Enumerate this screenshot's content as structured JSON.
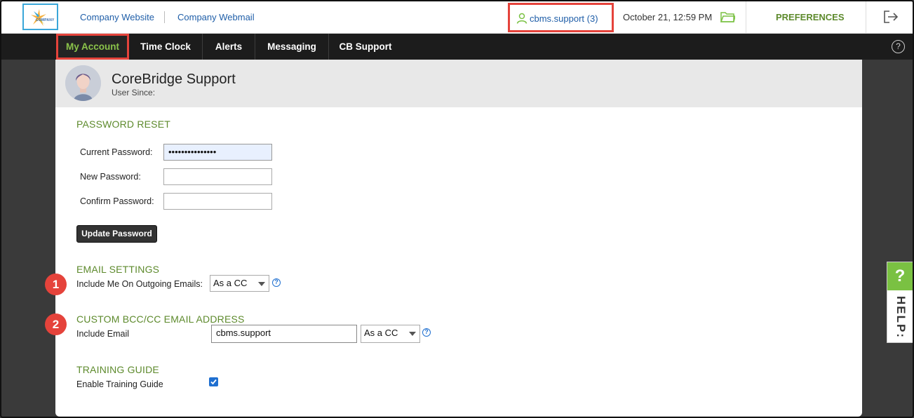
{
  "header": {
    "logo_text": "COMPANY",
    "links": [
      "Company Website",
      "Company Webmail"
    ],
    "user_label": "cbms.support (3)",
    "datetime": "October 21, 12:59 PM",
    "preferences_label": "PREFERENCES"
  },
  "nav": {
    "items": [
      "My Account",
      "Time Clock",
      "Alerts",
      "Messaging",
      "CB Support"
    ],
    "active": "My Account",
    "help_glyph": "?"
  },
  "profile": {
    "name": "CoreBridge Support",
    "since_label": "User Since:"
  },
  "password_reset": {
    "title": "PASSWORD RESET",
    "current_label": "Current Password:",
    "current_value": "•••••••••••••••",
    "new_label": "New Password:",
    "new_value": "",
    "confirm_label": "Confirm Password:",
    "confirm_value": "",
    "button_label": "Update Password"
  },
  "email_settings": {
    "title": "EMAIL SETTINGS",
    "include_label": "Include Me On Outgoing Emails:",
    "include_value": "As a CC",
    "help_glyph": "?"
  },
  "custom_bcc": {
    "title": "CUSTOM BCC/CC EMAIL ADDRESS",
    "include_label": "Include Email",
    "email_value": "cbms.support",
    "mode_value": "As a CC",
    "help_glyph": "?"
  },
  "training": {
    "title": "TRAINING GUIDE",
    "enable_label": "Enable Training Guide",
    "enabled": true
  },
  "callouts": [
    "1",
    "2"
  ],
  "help_tab": {
    "glyph": "?",
    "label": "HELP:"
  },
  "colors": {
    "accent_green": "#5d8a2c",
    "nav_active": "#8bc34a",
    "callout_red": "#e5433b",
    "link_blue": "#1f5ea8"
  }
}
